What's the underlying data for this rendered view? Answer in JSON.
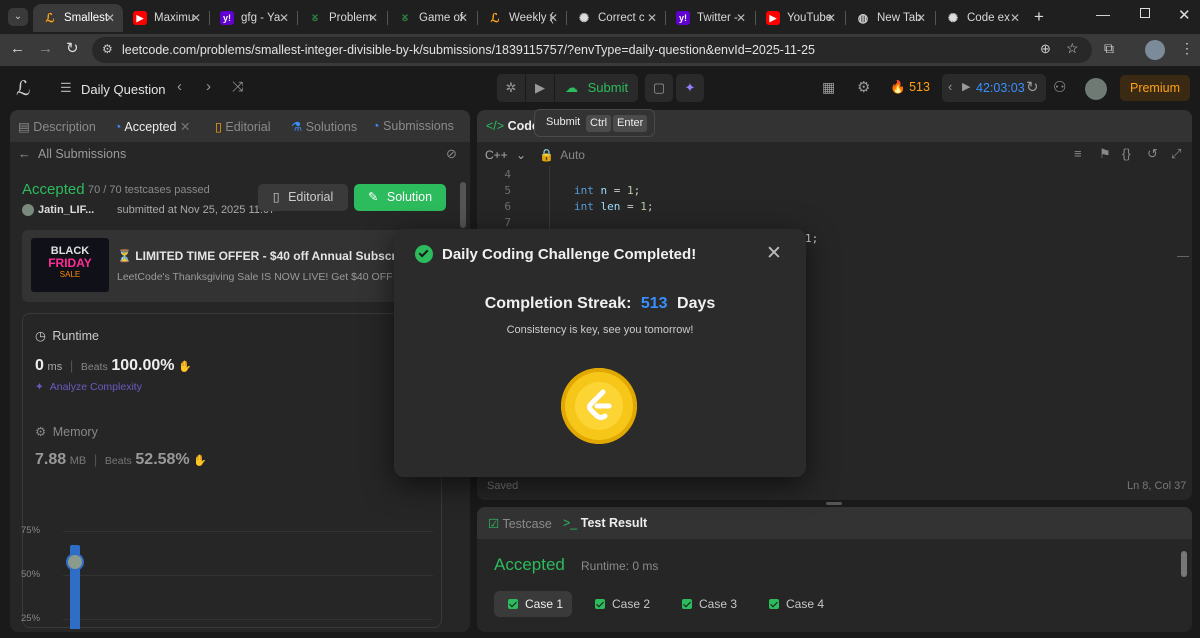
{
  "browser": {
    "tabs": [
      {
        "label": "Smallest",
        "favicon": "leetcode-icon",
        "active": true
      },
      {
        "label": "Maximu",
        "favicon": "youtube-icon"
      },
      {
        "label": "gfg - Ya",
        "favicon": "yahoo-icon"
      },
      {
        "label": "Problem",
        "favicon": "gfg-icon"
      },
      {
        "label": "Game of",
        "favicon": "gfg-icon"
      },
      {
        "label": "Weekly (",
        "favicon": "leetcode-icon"
      },
      {
        "label": "Correct c",
        "favicon": "chatgpt-icon"
      },
      {
        "label": "Twitter -",
        "favicon": "yahoo-icon"
      },
      {
        "label": "YouTube",
        "favicon": "youtube-icon"
      },
      {
        "label": "New Tab",
        "favicon": "globe-icon"
      },
      {
        "label": "Code ex",
        "favicon": "chatgpt-icon"
      }
    ],
    "url": "leetcode.com/problems/smallest-integer-divisible-by-k/submissions/1839115757/?envType=daily-question&envId=2025-11-25"
  },
  "nav": {
    "daily_question": "Daily Question",
    "submit": "Submit",
    "streak": "513",
    "timer": "42:03:03",
    "premium": "Premium"
  },
  "tooltip": {
    "label": "Submit",
    "key1": "Ctrl",
    "key2": "Enter"
  },
  "left_panel": {
    "tabs": [
      "Description",
      "Accepted",
      "Editorial",
      "Solutions",
      "Submissions"
    ],
    "all_submissions": "All Submissions",
    "status": "Accepted",
    "testcases": "70 / 70 testcases passed",
    "user": "Jatin_LIF...",
    "submitted": "submitted at Nov 25, 2025 11:07",
    "editorial_btn": "Editorial",
    "solution_btn": "Solution",
    "promo_title": "⏳ LIMITED TIME OFFER - $40 off Annual Subscrip",
    "promo_sub": "LeetCode's Thanksgiving Sale IS NOW LIVE! Get $40 OFF - Y",
    "promo_img_line1": "BLACK",
    "promo_img_line2": "FRIDAY",
    "promo_img_line3": "SALE",
    "runtime_label": "Runtime",
    "runtime_value": "0",
    "runtime_unit": "ms",
    "beats": "Beats",
    "runtime_beats": "100.00%",
    "analyze": "Analyze Complexity",
    "memory_label": "Memory",
    "memory_value": "7.88",
    "memory_unit": "MB",
    "memory_beats": "52.58%",
    "y_ticks": [
      "75%",
      "50%",
      "25%"
    ]
  },
  "code_panel": {
    "title": "Code",
    "language": "C++",
    "mode": "Auto",
    "lines": [
      {
        "n": "4",
        "text": ""
      },
      {
        "n": "5",
        "text": "int n = 1;"
      },
      {
        "n": "6",
        "text": "int len = 1;"
      },
      {
        "n": "7",
        "text": ""
      }
    ],
    "hidden_tail": "1;",
    "saved": "Saved",
    "cursor": "Ln 8, Col 37"
  },
  "result_panel": {
    "testcase_tab": "Testcase",
    "result_tab": "Test Result",
    "status": "Accepted",
    "runtime": "Runtime: 0 ms",
    "cases": [
      "Case 1",
      "Case 2",
      "Case 3",
      "Case 4"
    ]
  },
  "modal": {
    "title": "Daily Coding Challenge Completed!",
    "streak_label": "Completion Streak:",
    "streak_value": "513",
    "streak_unit": "Days",
    "message": "Consistency is key, see you tomorrow!"
  },
  "colors": {
    "accent_green": "#2cbb5d",
    "streak_blue": "#3a8fff",
    "premium_orange": "#ffa116",
    "coin_gold": "#f6c619"
  }
}
